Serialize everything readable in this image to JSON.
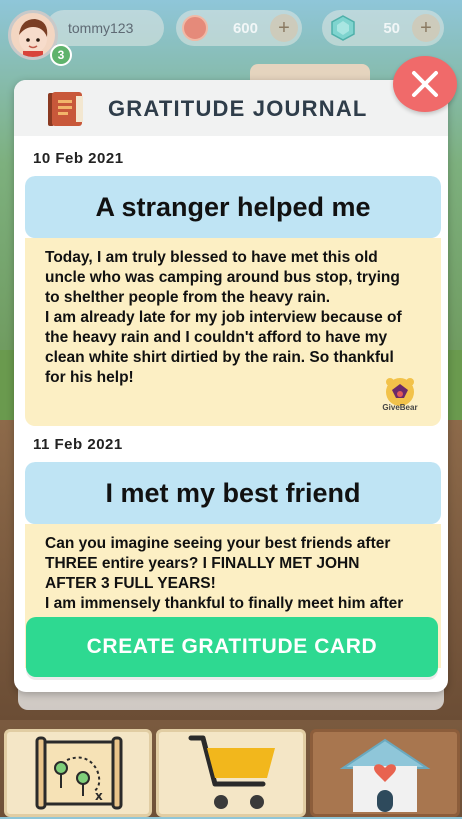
{
  "user": {
    "username": "tommy123",
    "level": "3"
  },
  "currency": {
    "coins": "600",
    "gems": "50",
    "plus_label": "+"
  },
  "modal": {
    "title": "GRATITUDE JOURNAL",
    "close_symbol": "✕",
    "entries": [
      {
        "date": "10 Feb 2021",
        "heading": "A stranger helped me",
        "lines": [
          "Today, I am truly blessed to have met this old",
          "uncle who was  camping around bus stop, trying",
          "to shelther people from the heavy rain.",
          "I am already late for my job interview because of",
          "the heavy rain and I couldn't afford to have my",
          "clean white shirt dirtied by the rain. So thankful",
          "for his help!"
        ],
        "stamp": "GiveBear"
      },
      {
        "date": "11 Feb 2021",
        "heading": "I met my best friend",
        "lines": [
          "Can you imagine seeing your best friends after",
          "THREE entire years? I FINALLY MET JOHN",
          "AFTER 3 FULL YEARS!",
          "I am immensely thankful to finally meet him after"
        ]
      }
    ],
    "create_button": "CREATE GRATITUDE CARD"
  },
  "colors": {
    "accent_green": "#2ed991",
    "heading_blue": "#bfe4f4",
    "body_yellow": "#fcefc4",
    "close_red": "#f06a6a"
  },
  "bottom_nav": [
    "map-icon",
    "shopping-cart-icon",
    "home-heart-icon"
  ]
}
